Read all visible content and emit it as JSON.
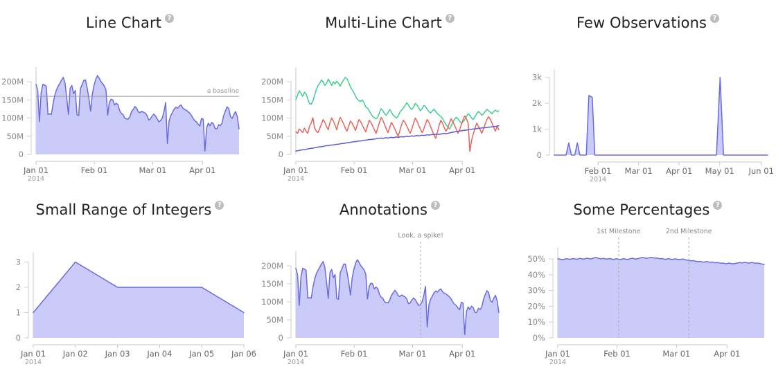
{
  "page": {
    "background": "#ffffff",
    "help_icon": "help-circle-icon",
    "help_glyph": "?"
  },
  "palette": {
    "line_blue": "#6a6ae0",
    "fill_blue": "#cbcbfa",
    "line_green": "#3ecf8e",
    "line_red": "#e8645a",
    "axis_grey": "#c9c9c9",
    "tick_text": "#888888",
    "title_text": "#222222",
    "annotation_grey": "#999999"
  },
  "charts": [
    {
      "id": "line-chart",
      "title": "Line Chart",
      "type": "area",
      "ylabel": "",
      "xlabel": "",
      "y_ticks": [
        "0",
        "50M",
        "100M",
        "150M",
        "200M"
      ],
      "y_tick_values": [
        0,
        50000000,
        100000000,
        150000000,
        200000000
      ],
      "ylim": [
        0,
        225000000
      ],
      "x_ticks": [
        "Jan 01",
        "Feb 01",
        "Mar 01",
        "Apr 01"
      ],
      "x_year": "2014",
      "annotations": [
        {
          "kind": "horizontal-baseline",
          "label": "a baseline",
          "value": 160000000
        }
      ],
      "series": [
        {
          "name": "series-1",
          "color": "#6a6ae0",
          "fill": "#cbcbfa",
          "values": [
            193,
            175,
            90,
            170,
            193,
            191,
            188,
            110,
            112,
            110,
            140,
            163,
            178,
            188,
            196,
            205,
            212,
            196,
            155,
            110,
            182,
            190,
            167,
            176,
            109,
            107,
            181,
            192,
            204,
            205,
            182,
            155,
            119,
            166,
            190,
            207,
            217,
            210,
            201,
            195,
            189,
            177,
            108,
            143,
            152,
            150,
            136,
            141,
            137,
            121,
            113,
            110,
            100,
            98,
            97,
            104,
            118,
            124,
            132,
            127,
            117,
            115,
            119,
            116,
            114,
            108,
            95,
            97,
            105,
            111,
            106,
            98,
            90,
            93,
            100,
            118,
            143,
            30,
            92,
            107,
            116,
            125,
            130,
            127,
            133,
            136,
            128,
            124,
            122,
            118,
            114,
            108,
            100,
            93,
            90,
            83,
            78,
            99,
            97,
            9,
            73,
            86,
            79,
            88,
            84,
            71,
            70,
            82,
            79,
            86,
            107,
            120,
            131,
            126,
            104,
            99,
            110,
            118,
            103,
            70
          ]
        }
      ]
    },
    {
      "id": "multi-line-chart",
      "title": "Multi-Line Chart",
      "type": "line",
      "y_ticks": [
        "0",
        "50M",
        "100M",
        "150M",
        "200M"
      ],
      "y_tick_values": [
        0,
        50000000,
        100000000,
        150000000,
        200000000
      ],
      "ylim": [
        0,
        225000000
      ],
      "x_ticks": [
        "Jan 01",
        "Feb 01",
        "Mar 01",
        "Apr 01"
      ],
      "x_year": "2014",
      "series": [
        {
          "name": "series-green",
          "color": "#3ecf8e",
          "values": [
            151,
            163,
            175,
            168,
            160,
            171,
            166,
            152,
            140,
            138,
            147,
            163,
            178,
            190,
            196,
            205,
            199,
            190,
            196,
            207,
            199,
            190,
            200,
            194,
            201,
            196,
            188,
            198,
            205,
            212,
            208,
            198,
            186,
            178,
            170,
            160,
            152,
            148,
            146,
            150,
            142,
            130,
            128,
            120,
            112,
            105,
            101,
            98,
            102,
            115,
            126,
            120,
            112,
            108,
            115,
            124,
            117,
            108,
            104,
            100,
            106,
            116,
            122,
            128,
            134,
            142,
            136,
            128,
            124,
            130,
            140,
            136,
            128,
            120,
            126,
            135,
            132,
            124,
            118,
            114,
            120,
            124,
            118,
            112,
            108,
            104,
            98,
            90,
            82,
            76,
            70,
            78,
            88,
            96,
            102,
            98,
            92,
            86,
            90,
            96,
            104,
            112,
            108,
            100,
            96,
            104,
            112,
            118,
            114,
            108,
            112,
            118,
            124,
            120,
            116,
            112,
            118,
            122,
            118,
            120
          ]
        },
        {
          "name": "series-red",
          "color": "#e8645a",
          "values": [
            62,
            58,
            70,
            66,
            60,
            72,
            64,
            58,
            78,
            86,
            101,
            72,
            64,
            60,
            72,
            84,
            96,
            88,
            76,
            68,
            88,
            100,
            92,
            80,
            68,
            88,
            102,
            94,
            84,
            72,
            64,
            78,
            92,
            86,
            76,
            66,
            82,
            96,
            90,
            80,
            70,
            62,
            78,
            94,
            88,
            78,
            68,
            58,
            72,
            88,
            102,
            94,
            82,
            70,
            60,
            74,
            88,
            80,
            70,
            60,
            50,
            66,
            82,
            94,
            88,
            78,
            68,
            58,
            70,
            86,
            100,
            92,
            80,
            70,
            60,
            70,
            84,
            96,
            88,
            76,
            64,
            54,
            44,
            62,
            80,
            94,
            86,
            74,
            64,
            72,
            86,
            98,
            90,
            80,
            70,
            58,
            68,
            82,
            96,
            106,
            98,
            86,
            8,
            38,
            56,
            72,
            86,
            78,
            68,
            58,
            70,
            84,
            96,
            104,
            96,
            86,
            74,
            64,
            78,
            68
          ]
        },
        {
          "name": "series-blue",
          "color": "#5b5bd6",
          "values": [
            9,
            10,
            11,
            12,
            13,
            13,
            14,
            15,
            16,
            17,
            17,
            18,
            19,
            20,
            21,
            21,
            22,
            23,
            24,
            24,
            25,
            26,
            26,
            27,
            28,
            28,
            29,
            30,
            30,
            31,
            32,
            33,
            33,
            34,
            35,
            35,
            36,
            37,
            37,
            38,
            39,
            39,
            40,
            41,
            41,
            42,
            42,
            43,
            44,
            44,
            45,
            44,
            45,
            46,
            45,
            46,
            47,
            46,
            47,
            48,
            47,
            48,
            49,
            48,
            49,
            50,
            49,
            50,
            51,
            50,
            51,
            52,
            51,
            52,
            53,
            52,
            53,
            54,
            53,
            54,
            55,
            54,
            55,
            56,
            55,
            56,
            57,
            58,
            57,
            58,
            59,
            60,
            61,
            62,
            63,
            63,
            64,
            65,
            66,
            66,
            67,
            68,
            69,
            69,
            70,
            70,
            71,
            72,
            72,
            73,
            73,
            74,
            74,
            75,
            75,
            76,
            77,
            77,
            78,
            79
          ]
        }
      ]
    },
    {
      "id": "few-observations-chart",
      "title": "Few Observations",
      "type": "area",
      "y_ticks": [
        "0",
        "1k",
        "2k",
        "3k"
      ],
      "y_tick_values": [
        0,
        1000,
        2000,
        3000
      ],
      "ylim": [
        0,
        3100
      ],
      "x_ticks": [
        "Feb 01",
        "Mar 01",
        "Apr 01",
        "May 01",
        "Jun 01"
      ],
      "x_year": "2014",
      "series": [
        {
          "name": "series-1",
          "color": "#6a6ae0",
          "fill": "#cbcbfa",
          "points": [
            {
              "x": 0.0,
              "y": 0
            },
            {
              "x": 0.055,
              "y": 0
            },
            {
              "x": 0.068,
              "y": 470
            },
            {
              "x": 0.08,
              "y": 0
            },
            {
              "x": 0.096,
              "y": 0
            },
            {
              "x": 0.108,
              "y": 470
            },
            {
              "x": 0.12,
              "y": 0
            },
            {
              "x": 0.15,
              "y": 0
            },
            {
              "x": 0.162,
              "y": 2300
            },
            {
              "x": 0.178,
              "y": 2230
            },
            {
              "x": 0.19,
              "y": 0
            },
            {
              "x": 0.76,
              "y": 0
            },
            {
              "x": 0.777,
              "y": 3000
            },
            {
              "x": 0.793,
              "y": 0
            },
            {
              "x": 1.0,
              "y": 0
            }
          ]
        }
      ]
    },
    {
      "id": "small-range-of-integers-chart",
      "title": "Small Range of Integers",
      "type": "area",
      "y_ticks": [
        "0",
        "1",
        "2",
        "3"
      ],
      "y_tick_values": [
        0,
        1,
        2,
        3
      ],
      "ylim": [
        0,
        3.15
      ],
      "x_ticks": [
        "Jan 01",
        "Jan 02",
        "Jan 03",
        "Jan 04",
        "Jan 05",
        "Jan 06"
      ],
      "x_year": "2014",
      "series": [
        {
          "name": "series-1",
          "color": "#6a6ae0",
          "fill": "#cbcbfa",
          "values": [
            1,
            3,
            2,
            2,
            2,
            1
          ]
        }
      ]
    },
    {
      "id": "annotations-chart",
      "title": "Annotations",
      "type": "area",
      "y_ticks": [
        "0",
        "50M",
        "100M",
        "150M",
        "200M"
      ],
      "y_tick_values": [
        0,
        50000000,
        100000000,
        150000000,
        200000000
      ],
      "ylim": [
        0,
        225000000
      ],
      "x_ticks": [
        "Jan 01",
        "Feb 01",
        "Mar 01",
        "Apr 01"
      ],
      "x_year": "2014",
      "annotations": [
        {
          "kind": "vertical-marker",
          "label": "Look, a spike!",
          "x_fraction": 0.615
        }
      ],
      "series": [
        {
          "name": "series-1",
          "color": "#6a6ae0",
          "fill": "#cbcbfa",
          "values": [
            193,
            175,
            90,
            170,
            193,
            191,
            188,
            110,
            112,
            110,
            140,
            163,
            178,
            188,
            196,
            205,
            212,
            196,
            155,
            110,
            182,
            190,
            167,
            176,
            109,
            107,
            181,
            192,
            204,
            205,
            182,
            155,
            119,
            166,
            190,
            207,
            217,
            210,
            201,
            195,
            189,
            177,
            108,
            143,
            152,
            150,
            136,
            141,
            137,
            121,
            113,
            110,
            100,
            98,
            97,
            104,
            118,
            124,
            132,
            127,
            117,
            115,
            119,
            116,
            114,
            108,
            95,
            97,
            105,
            111,
            106,
            98,
            90,
            93,
            100,
            118,
            143,
            30,
            92,
            107,
            116,
            125,
            130,
            127,
            133,
            136,
            128,
            124,
            122,
            118,
            114,
            108,
            100,
            93,
            90,
            83,
            78,
            99,
            97,
            9,
            73,
            86,
            79,
            88,
            84,
            71,
            70,
            82,
            79,
            86,
            107,
            120,
            131,
            126,
            104,
            99,
            110,
            118,
            103,
            70
          ]
        }
      ]
    },
    {
      "id": "some-percentages-chart",
      "title": "Some Percentages",
      "type": "area",
      "y_ticks": [
        "0%",
        "10%",
        "20%",
        "30%",
        "40%",
        "50%"
      ],
      "y_tick_values": [
        0,
        10,
        20,
        30,
        40,
        50
      ],
      "ylim": [
        0,
        54
      ],
      "x_ticks": [
        "Jan 01",
        "Feb 01",
        "Mar 01",
        "Apr 01"
      ],
      "x_year": "2014",
      "annotations": [
        {
          "kind": "vertical-marker",
          "label": "1st Milestone",
          "x_fraction": 0.295
        },
        {
          "kind": "vertical-marker",
          "label": "2nd Milestone",
          "x_fraction": 0.635
        }
      ],
      "series": [
        {
          "name": "series-1",
          "color": "#6a6ae0",
          "fill": "#cbcbfa",
          "values": [
            50.2,
            50.0,
            49.7,
            49.6,
            49.9,
            50.2,
            50.0,
            49.8,
            50.1,
            50.3,
            50.0,
            49.8,
            50.2,
            50.4,
            50.1,
            49.9,
            50.3,
            50.5,
            50.2,
            50.0,
            50.4,
            50.7,
            51.0,
            50.6,
            50.3,
            50.1,
            50.4,
            50.2,
            49.9,
            50.1,
            50.3,
            50.0,
            49.7,
            49.9,
            50.2,
            49.8,
            49.6,
            49.9,
            50.2,
            50.0,
            49.7,
            49.9,
            50.3,
            50.5,
            50.2,
            49.9,
            50.2,
            50.5,
            50.8,
            51.0,
            50.7,
            50.4,
            50.6,
            50.9,
            51.1,
            50.8,
            50.5,
            50.7,
            50.4,
            50.1,
            50.3,
            50.0,
            49.8,
            50.0,
            50.2,
            49.9,
            49.7,
            49.9,
            50.1,
            49.8,
            49.6,
            49.8,
            50.0,
            49.7,
            49.4,
            49.2,
            49.0,
            48.8,
            49.0,
            48.7,
            48.5,
            48.3,
            48.5,
            48.2,
            48.0,
            48.2,
            48.4,
            48.1,
            47.9,
            48.1,
            47.8,
            47.6,
            47.8,
            47.5,
            47.3,
            47.5,
            47.2,
            47.0,
            47.2,
            47.4,
            47.1,
            46.9,
            47.1,
            47.3,
            47.6,
            47.8,
            47.5,
            47.7,
            47.9,
            47.6,
            47.4,
            47.6,
            47.8,
            47.5,
            47.3,
            47.5,
            47.2,
            47.0,
            46.8,
            46.4
          ]
        }
      ]
    }
  ]
}
